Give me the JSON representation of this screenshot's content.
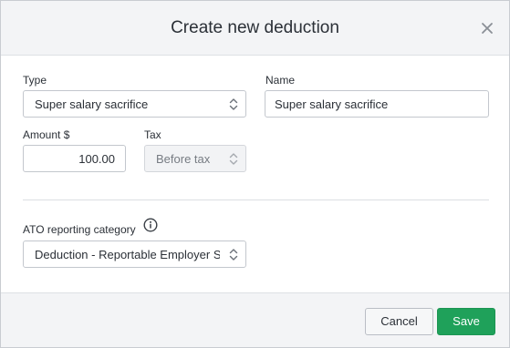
{
  "dialog": {
    "title": "Create new deduction",
    "close_icon": "close-icon"
  },
  "form": {
    "type": {
      "label": "Type",
      "value": "Super salary sacrifice",
      "icon": "select-chevron-icon"
    },
    "name": {
      "label": "Name",
      "value": "Super salary sacrifice"
    },
    "amount": {
      "label": "Amount $",
      "value": "100.00"
    },
    "tax": {
      "label": "Tax",
      "value": "Before tax",
      "disabled": true,
      "icon": "select-chevron-icon"
    },
    "ato_category": {
      "label": "ATO reporting category",
      "value": "Deduction - Reportable Employer Super Contribution",
      "info_icon": "info-icon",
      "icon": "select-chevron-icon"
    }
  },
  "footer": {
    "cancel_label": "Cancel",
    "save_label": "Save"
  },
  "colors": {
    "header_bg": "#f3f4f6",
    "save_green": "#1fa15a",
    "border": "#c3c7cd",
    "text": "#2b3037"
  }
}
